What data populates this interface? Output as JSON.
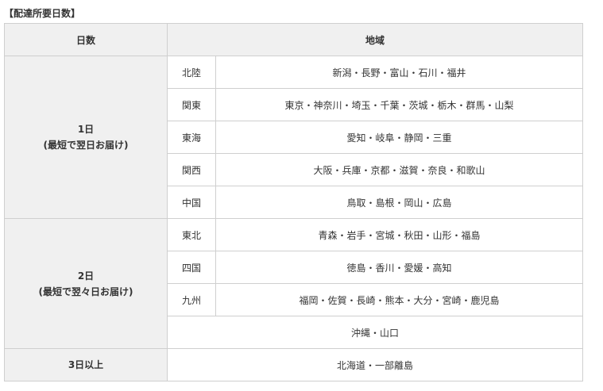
{
  "heading": "【配達所要日数】",
  "table": {
    "header": {
      "days": "日数",
      "area": "地域"
    },
    "groups": [
      {
        "days_line1": "1日",
        "days_line2": "(最短で翌日お届け)",
        "rows": [
          {
            "region": "北陸",
            "prefs": "新潟・長野・富山・石川・福井"
          },
          {
            "region": "関東",
            "prefs": "東京・神奈川・埼玉・千葉・茨城・栃木・群馬・山梨"
          },
          {
            "region": "東海",
            "prefs": "愛知・岐阜・静岡・三重"
          },
          {
            "region": "関西",
            "prefs": "大阪・兵庫・京都・滋賀・奈良・和歌山"
          },
          {
            "region": "中国",
            "prefs": "鳥取・島根・岡山・広島"
          }
        ]
      },
      {
        "days_line1": "2日",
        "days_line2": "(最短で翌々日お届け)",
        "rows": [
          {
            "region": "東北",
            "prefs": "青森・岩手・宮城・秋田・山形・福島"
          },
          {
            "region": "四国",
            "prefs": "徳島・香川・愛媛・高知"
          },
          {
            "region": "九州",
            "prefs": "福岡・佐賀・長崎・熊本・大分・宮崎・鹿児島"
          }
        ],
        "extra": "沖縄・山口"
      },
      {
        "days_line1": "3日以上",
        "extra": "北海道・一部離島"
      }
    ]
  }
}
